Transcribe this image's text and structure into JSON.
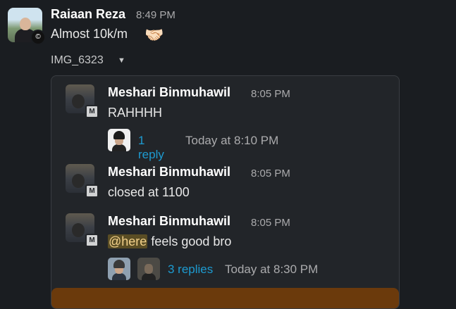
{
  "message": {
    "author": "Raiaan Reza",
    "time": "8:49 PM",
    "text": "Almost 10k/m",
    "emoji": "🤝🏻",
    "avatar_badge": "©",
    "attachment": {
      "label": "IMG_6323",
      "toggle_icon": "caret-down-icon"
    }
  },
  "embedded": {
    "messages": [
      {
        "author": "Meshari Binmuhawil",
        "time": "8:05 PM",
        "text": "RAHHHH",
        "badge": "M",
        "thread": {
          "replies": "1 reply",
          "last": "Today at 8:10 PM"
        }
      },
      {
        "author": "Meshari Binmuhawil",
        "time": "8:05 PM",
        "text": "closed at 1100",
        "badge": "M"
      },
      {
        "author": "Meshari Binmuhawil",
        "time": "8:05 PM",
        "mention": "@here",
        "text": " feels good bro",
        "badge": "M",
        "thread": {
          "replies": "3 replies",
          "last": "Today at 8:30 PM"
        }
      }
    ]
  },
  "colors": {
    "background": "#1a1d21",
    "link": "#1d9bd1",
    "mention_bg": "#5a4d24",
    "accent_bar": "#6b3a0c"
  }
}
